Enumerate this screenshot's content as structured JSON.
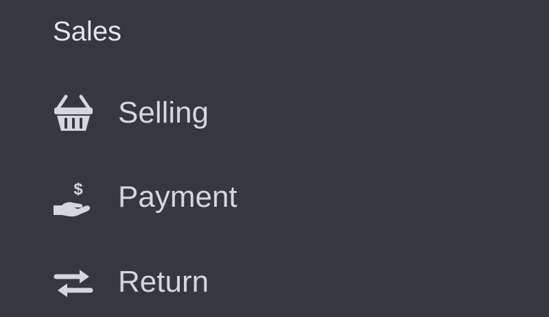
{
  "sidebar": {
    "section_title": "Sales",
    "items": [
      {
        "label": "Selling",
        "icon": "shopping-basket-icon"
      },
      {
        "label": "Payment",
        "icon": "hand-holding-dollar-icon"
      },
      {
        "label": "Return",
        "icon": "exchange-arrows-icon"
      }
    ]
  },
  "colors": {
    "background": "#353841",
    "text": "#d4d7de",
    "icon": "#d4d7de"
  }
}
